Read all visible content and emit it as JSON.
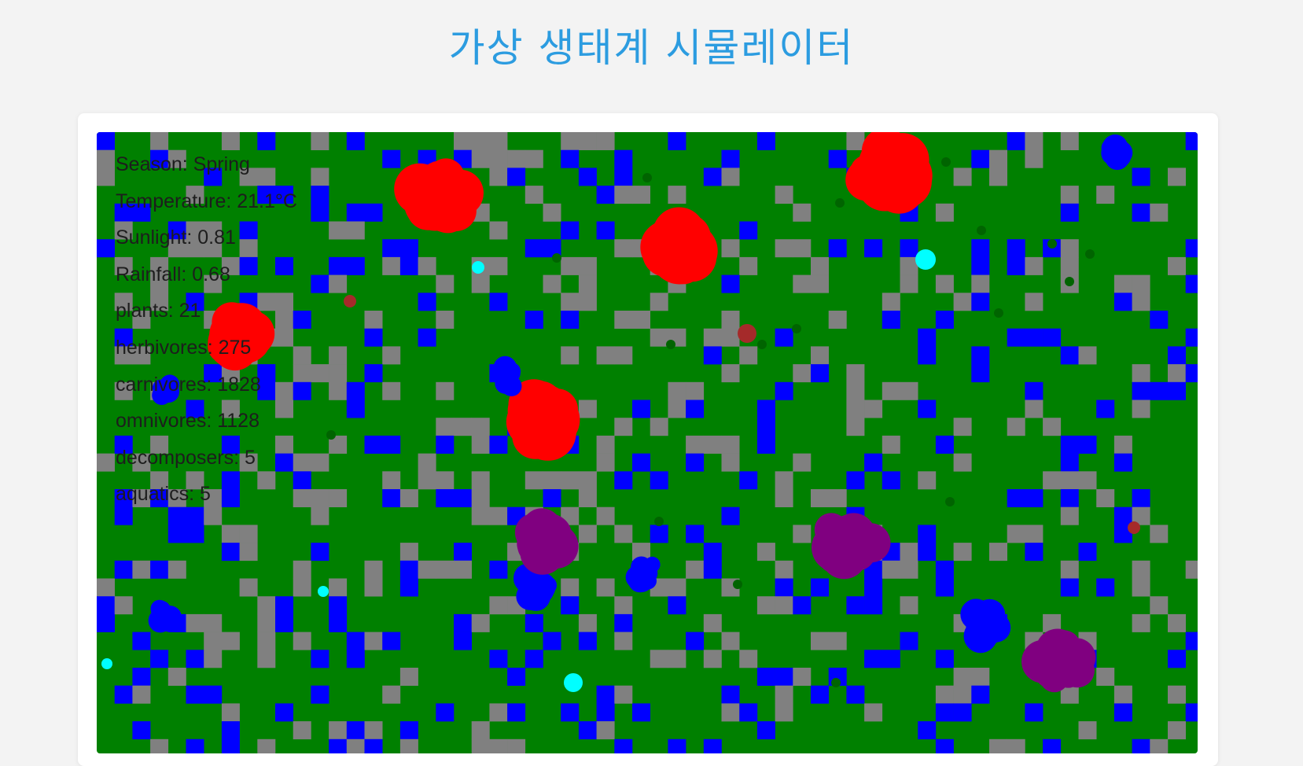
{
  "page": {
    "title": "가상 생태계 시뮬레이터"
  },
  "simulation": {
    "colors": {
      "grass": "#008000",
      "water": "#0000ff",
      "rock": "#808080",
      "carnivore": "#ff0000",
      "herbivore": "#0000ff",
      "omnivore": "#800080",
      "aquatic": "#00ffff",
      "decomposer": "#a52a2a",
      "plant": "#006400"
    },
    "stats": [
      {
        "key": "season",
        "text": "Season: Spring"
      },
      {
        "key": "temperature",
        "text": "Temperature: 21.1°C"
      },
      {
        "key": "sunlight",
        "text": "Sunlight: 0.81"
      },
      {
        "key": "rainfall",
        "text": "Rainfall: 0.68"
      },
      {
        "key": "plants",
        "text": "plants: 21"
      },
      {
        "key": "herbivores",
        "text": "herbivores: 275"
      },
      {
        "key": "carnivores",
        "text": "carnivores: 1828"
      },
      {
        "key": "omnivores",
        "text": "omnivores: 1128"
      },
      {
        "key": "decomposers",
        "text": "decomposers: 5"
      },
      {
        "key": "aquatics",
        "text": "aquatics: 5"
      }
    ]
  }
}
